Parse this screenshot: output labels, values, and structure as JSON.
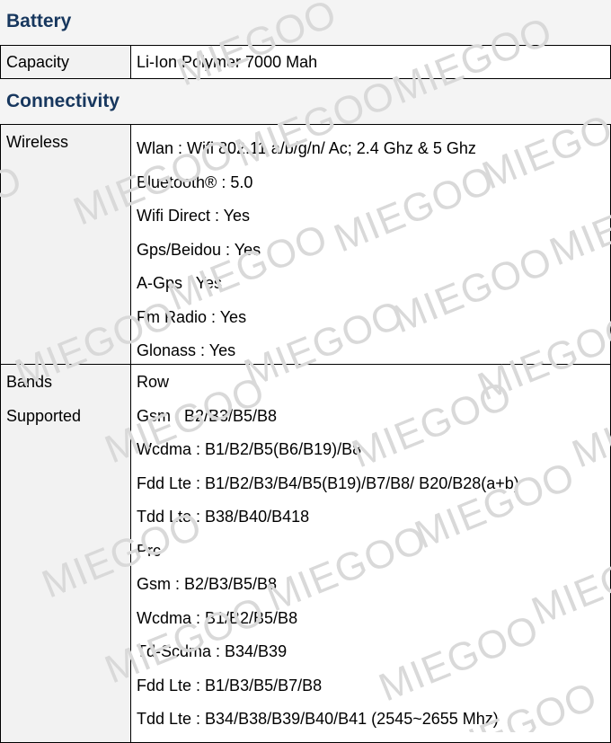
{
  "battery": {
    "title": "Battery",
    "rows": [
      {
        "label": "Capacity",
        "value": "Li-Ion Polymer 7000 Mah"
      }
    ]
  },
  "connectivity": {
    "title": "Connectivity",
    "wireless": {
      "label": "Wireless",
      "lines": [
        "Wlan : Wifi 802.11 a/b/g/n/ Ac; 2.4 Ghz & 5 Ghz",
        "Bluetooth® : 5.0",
        "Wifi Direct : Yes",
        "Gps/Beidou : Yes",
        "A-Gps : Yes",
        "Fm Radio : Yes",
        "Glonass : Yes"
      ]
    },
    "bands": {
      "label_lines": [
        "Bands",
        "Supported"
      ],
      "lines": [
        "Row",
        "Gsm : B2/B3/B5/B8",
        "Wcdma : B1/B2/B5(B6/B19)/B8",
        "Fdd Lte : B1/B2/B3/B4/B5(B19)/B7/B8/ B20/B28(a+b)",
        "Tdd Lte : B38/B40/B418",
        "Prc",
        "Gsm : B2/B3/B5/B8",
        "Wcdma : B1/B2/B5/B8",
        "Td-Scdma : B34/B39",
        "Fdd Lte : B1/B3/B5/B7/B8",
        "Tdd Lte : B34/B38/B39/B40/B41 (2545~2655 Mhz)"
      ]
    }
  },
  "watermark": "MIEGOO",
  "colors": {
    "section_title": "#17375e",
    "label_bg": "#f2f2f2",
    "watermark": "#d9d9d9"
  }
}
